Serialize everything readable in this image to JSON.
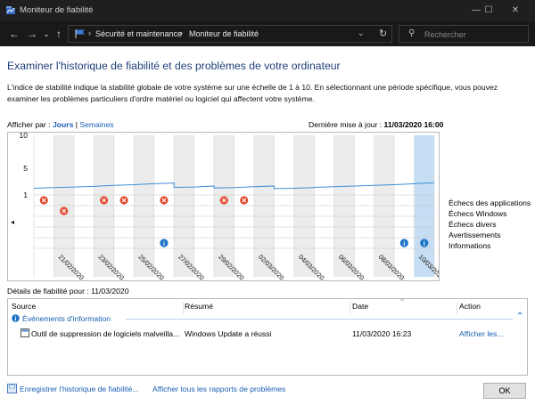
{
  "window": {
    "title": "Moniteur de fiabilité",
    "minimize_glyph": "—",
    "maximize_glyph": "☐",
    "close_glyph": "✕"
  },
  "nav": {
    "back_glyph": "←",
    "forward_glyph": "→",
    "recent_glyph": "⌄",
    "up_glyph": "↑",
    "breadcrumb": [
      "Sécurité et maintenance",
      "Moniteur de fiabilité"
    ],
    "breadcrumb_separator": "›",
    "dropdown_glyph": "⌄",
    "refresh_glyph": "↻",
    "search_icon_glyph": "⚲",
    "search_placeholder": "Rechercher"
  },
  "page": {
    "heading": "Examiner l'historique de fiabilité et des problèmes de votre ordinateur",
    "intro": "L'indice de stabilité indique la stabilité globale de votre système sur une échelle de 1 à 10. En sélectionnant une période spécifique, vous pouvez examiner les problèmes particuliers d'ordre matériel ou logiciel qui affectent votre système.",
    "view_by_label": "Afficher par :",
    "view_days": "Jours",
    "view_sep": "|",
    "view_weeks": "Semaines",
    "last_update_label": "Dernière mise à jour :",
    "last_update_value": "11/03/2020 16:00"
  },
  "chart_data": {
    "type": "line",
    "y_ticks": [
      "10",
      "5",
      "1"
    ],
    "ylim": [
      1,
      10
    ],
    "series": [
      {
        "values_by_column": [
          [
            2.0,
            2.1
          ],
          [
            2.1,
            2.2
          ],
          [
            2.2,
            2.3
          ],
          [
            2.3,
            2.45
          ],
          [
            2.45,
            2.55
          ],
          [
            2.55,
            2.7
          ],
          [
            2.7,
            2.8
          ],
          [
            2.15,
            2.2
          ],
          [
            2.2,
            2.35
          ],
          [
            2.05,
            2.1
          ],
          [
            2.1,
            2.25
          ],
          [
            2.25,
            2.35
          ],
          [
            1.95,
            2.0
          ],
          [
            2.0,
            2.1
          ],
          [
            2.15,
            2.25
          ],
          [
            2.25,
            2.35
          ],
          [
            2.35,
            2.45
          ],
          [
            2.45,
            2.55
          ],
          [
            2.55,
            2.7
          ],
          [
            2.7,
            2.85
          ]
        ]
      }
    ],
    "x_labels": [
      "21/02/2020",
      "23/02/2020",
      "25/02/2020",
      "27/02/2020",
      "29/02/2020",
      "02/03/2020",
      "04/03/2020",
      "06/03/2020",
      "08/03/2020",
      "10/03/2020"
    ],
    "columns": 20,
    "selected_column": 19,
    "event_rows": [
      "Échecs des applications",
      "Échecs Windows",
      "Échecs divers",
      "Avertissements",
      "Informations"
    ],
    "events": [
      {
        "column": 0,
        "row": 0,
        "kind": "error"
      },
      {
        "column": 1,
        "row": 1,
        "kind": "error"
      },
      {
        "column": 3,
        "row": 0,
        "kind": "error"
      },
      {
        "column": 4,
        "row": 0,
        "kind": "error"
      },
      {
        "column": 6,
        "row": 0,
        "kind": "error"
      },
      {
        "column": 9,
        "row": 0,
        "kind": "error"
      },
      {
        "column": 10,
        "row": 0,
        "kind": "error"
      },
      {
        "column": 6,
        "row": 4,
        "kind": "info"
      },
      {
        "column": 18,
        "row": 4,
        "kind": "info"
      },
      {
        "column": 19,
        "row": 4,
        "kind": "info"
      }
    ],
    "scroll_left_glyph": "◂",
    "scroll_right_glyph": "▸"
  },
  "details": {
    "title": "Détails de fiabilité pour : 11/03/2020",
    "sort_glyph": "^",
    "columns": [
      "Source",
      "Résumé",
      "Date",
      "Action"
    ],
    "group_label": "Événements d'information",
    "group_icon_glyph": "i",
    "collapse_glyph": "⌃",
    "rows": [
      {
        "source": "Outil de suppression de logiciels malveilla...",
        "summary": "Windows Update a réussi",
        "date": "11/03/2020 16:23",
        "action": "Afficher les..."
      }
    ]
  },
  "footer": {
    "save_history": "Enregistrer l'historique de fiabilité...",
    "show_all_reports": "Afficher tous les rapports de problèmes",
    "ok": "OK"
  },
  "colors": {
    "accent_blue": "#1a5fb4",
    "heading_blue": "#1e3f7a",
    "error_red": "#e04a2f",
    "info_blue": "#1e73c8",
    "line_blue": "#3c8ed6",
    "selected_column": "#c6def3"
  }
}
